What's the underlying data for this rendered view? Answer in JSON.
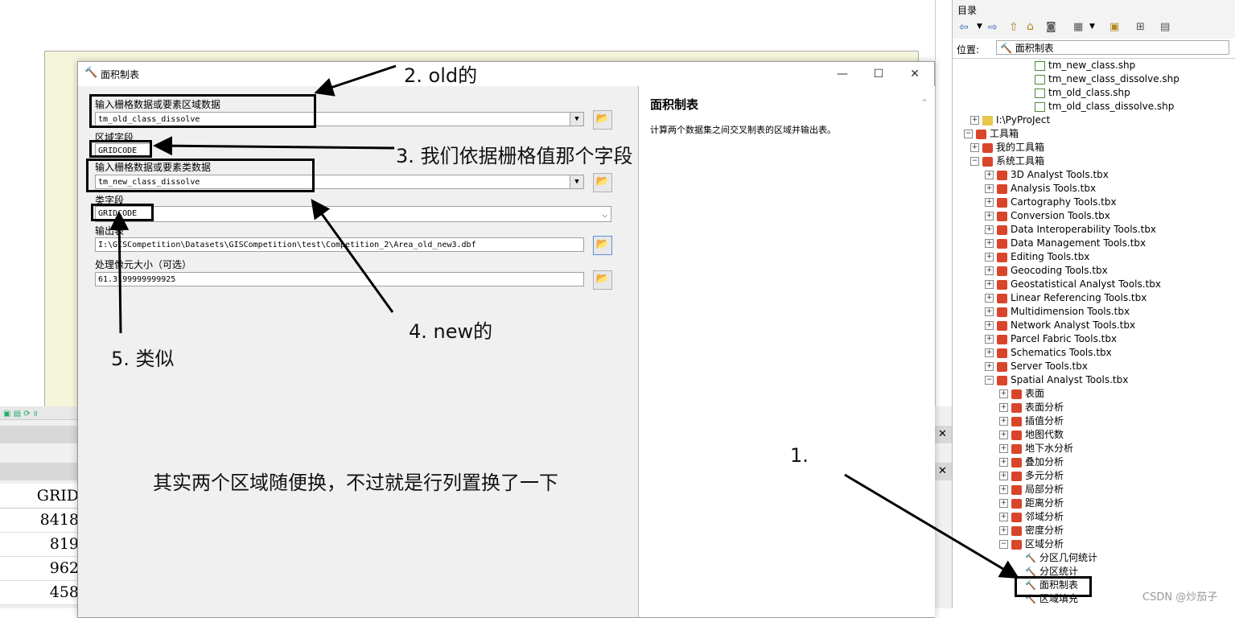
{
  "dialog": {
    "title": "面积制表",
    "minimize": "—",
    "maximize": "☐",
    "close": "✕",
    "fields": {
      "zone_input_label": "输入栅格数据或要素区域数据",
      "zone_input_value": "tm_old_class_dissolve",
      "zone_field_label": "区域字段",
      "zone_field_value": "GRIDCODE",
      "class_input_label": "输入栅格数据或要素类数据",
      "class_input_value": "tm_new_class_dissolve",
      "class_field_label": "类字段",
      "class_field_value": "GRIDCODE",
      "output_label": "输出表",
      "output_value": "I:\\GISCompetition\\Datasets\\GISCompetition\\test\\Competition_2\\Area_old_new3.dbf",
      "cellsize_label": "处理像元大小（可选）",
      "cellsize_value": "61.3199999999925"
    },
    "help": {
      "title": "面积制表",
      "body": "计算两个数据集之间交叉制表的区域并输出表。"
    }
  },
  "table": {
    "header": "GRID",
    "rows": [
      "8418",
      "819",
      "962",
      "458"
    ]
  },
  "catalog": {
    "title": "目录",
    "location_label": "位置:",
    "location_value": "面积制表",
    "items": [
      {
        "label": "tm_new_class.shp",
        "type": "shp",
        "indent": 5,
        "pm": ""
      },
      {
        "label": "tm_new_class_dissolve.shp",
        "type": "shp",
        "indent": 5,
        "pm": ""
      },
      {
        "label": "tm_old_class.shp",
        "type": "shp",
        "indent": 5,
        "pm": ""
      },
      {
        "label": "tm_old_class_dissolve.shp",
        "type": "shp",
        "indent": 5,
        "pm": ""
      },
      {
        "label": "I:\\PyProJect",
        "type": "folder",
        "indent": 1,
        "pm": "+"
      },
      {
        "label": "工具箱",
        "type": "tbx",
        "indent": 0,
        "pm": "-"
      },
      {
        "label": "我的工具箱",
        "type": "tbx",
        "indent": 1,
        "pm": "+"
      },
      {
        "label": "系统工具箱",
        "type": "tbx",
        "indent": 1,
        "pm": "-"
      },
      {
        "label": "3D Analyst Tools.tbx",
        "type": "tbx",
        "indent": 2,
        "pm": "+"
      },
      {
        "label": "Analysis Tools.tbx",
        "type": "tbx",
        "indent": 2,
        "pm": "+"
      },
      {
        "label": "Cartography Tools.tbx",
        "type": "tbx",
        "indent": 2,
        "pm": "+"
      },
      {
        "label": "Conversion Tools.tbx",
        "type": "tbx",
        "indent": 2,
        "pm": "+"
      },
      {
        "label": "Data Interoperability Tools.tbx",
        "type": "tbx",
        "indent": 2,
        "pm": "+"
      },
      {
        "label": "Data Management Tools.tbx",
        "type": "tbx",
        "indent": 2,
        "pm": "+"
      },
      {
        "label": "Editing Tools.tbx",
        "type": "tbx",
        "indent": 2,
        "pm": "+"
      },
      {
        "label": "Geocoding Tools.tbx",
        "type": "tbx",
        "indent": 2,
        "pm": "+"
      },
      {
        "label": "Geostatistical Analyst Tools.tbx",
        "type": "tbx",
        "indent": 2,
        "pm": "+"
      },
      {
        "label": "Linear Referencing Tools.tbx",
        "type": "tbx",
        "indent": 2,
        "pm": "+"
      },
      {
        "label": "Multidimension Tools.tbx",
        "type": "tbx",
        "indent": 2,
        "pm": "+"
      },
      {
        "label": "Network Analyst Tools.tbx",
        "type": "tbx",
        "indent": 2,
        "pm": "+"
      },
      {
        "label": "Parcel Fabric Tools.tbx",
        "type": "tbx",
        "indent": 2,
        "pm": "+"
      },
      {
        "label": "Schematics Tools.tbx",
        "type": "tbx",
        "indent": 2,
        "pm": "+"
      },
      {
        "label": "Server Tools.tbx",
        "type": "tbx",
        "indent": 2,
        "pm": "+"
      },
      {
        "label": "Spatial Analyst Tools.tbx",
        "type": "tbx",
        "indent": 2,
        "pm": "-"
      },
      {
        "label": "表面",
        "type": "tbx",
        "indent": 3,
        "pm": "+"
      },
      {
        "label": "表面分析",
        "type": "tbx",
        "indent": 3,
        "pm": "+"
      },
      {
        "label": "插值分析",
        "type": "tbx",
        "indent": 3,
        "pm": "+"
      },
      {
        "label": "地图代数",
        "type": "tbx",
        "indent": 3,
        "pm": "+"
      },
      {
        "label": "地下水分析",
        "type": "tbx",
        "indent": 3,
        "pm": "+"
      },
      {
        "label": "叠加分析",
        "type": "tbx",
        "indent": 3,
        "pm": "+"
      },
      {
        "label": "多元分析",
        "type": "tbx",
        "indent": 3,
        "pm": "+"
      },
      {
        "label": "局部分析",
        "type": "tbx",
        "indent": 3,
        "pm": "+"
      },
      {
        "label": "距离分析",
        "type": "tbx",
        "indent": 3,
        "pm": "+"
      },
      {
        "label": "邻域分析",
        "type": "tbx",
        "indent": 3,
        "pm": "+"
      },
      {
        "label": "密度分析",
        "type": "tbx",
        "indent": 3,
        "pm": "+"
      },
      {
        "label": "区域分析",
        "type": "tbx",
        "indent": 3,
        "pm": "-"
      },
      {
        "label": "分区几何统计",
        "type": "tool",
        "indent": 4,
        "pm": ""
      },
      {
        "label": "分区统计",
        "type": "tool",
        "indent": 4,
        "pm": ""
      },
      {
        "label": "面积制表",
        "type": "tool",
        "indent": 4,
        "pm": ""
      },
      {
        "label": "区域填充",
        "type": "tool",
        "indent": 4,
        "pm": ""
      }
    ]
  },
  "annotations": {
    "a1": "1.",
    "a2": "2. old的",
    "a3": "3. 我们依据栅格值那个字段",
    "a4": "4. new的",
    "a5": "5. 类似",
    "note": "其实两个区域随便换，不过就是行列置换了一下"
  },
  "watermark": "CSDN @炒茄子"
}
